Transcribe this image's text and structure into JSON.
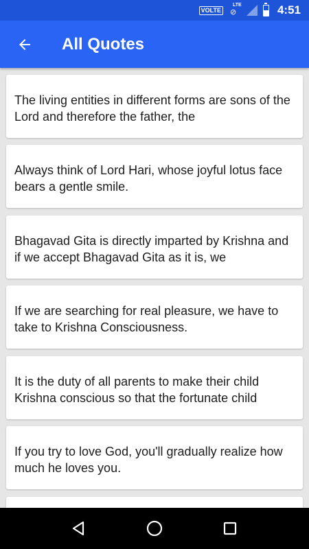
{
  "status_bar": {
    "volte": "VOLTE",
    "lte": "LTE",
    "time": "4:51",
    "battery_level": 0.5
  },
  "app_bar": {
    "title": "All Quotes",
    "back_icon": "arrow-back-icon"
  },
  "quotes": [
    {
      "text": "The living entities in different forms are sons of the Lord and therefore the father, the"
    },
    {
      "text": "Always think of Lord Hari, whose joyful lotus face bears a gentle smile."
    },
    {
      "text": "Bhagavad Gita is directly imparted by Krishna and if we accept Bhagavad Gita as it is, we"
    },
    {
      "text": "If we are searching for real pleasure, we have to take to Krishna Consciousness."
    },
    {
      "text": "It is the duty of all parents to make their child Krishna conscious so that the fortunate child"
    },
    {
      "text": "If you try to love God, you'll gradually realize how much he loves you."
    },
    {
      "text": ""
    }
  ],
  "nav_bar": {
    "back_icon": "triangle-back-icon",
    "home_icon": "circle-home-icon",
    "recents_icon": "square-recents-icon"
  },
  "colors": {
    "status_bar": "#1e54d8",
    "app_bar": "#2a64f5",
    "background": "#e6e6e6",
    "card": "#ffffff"
  }
}
